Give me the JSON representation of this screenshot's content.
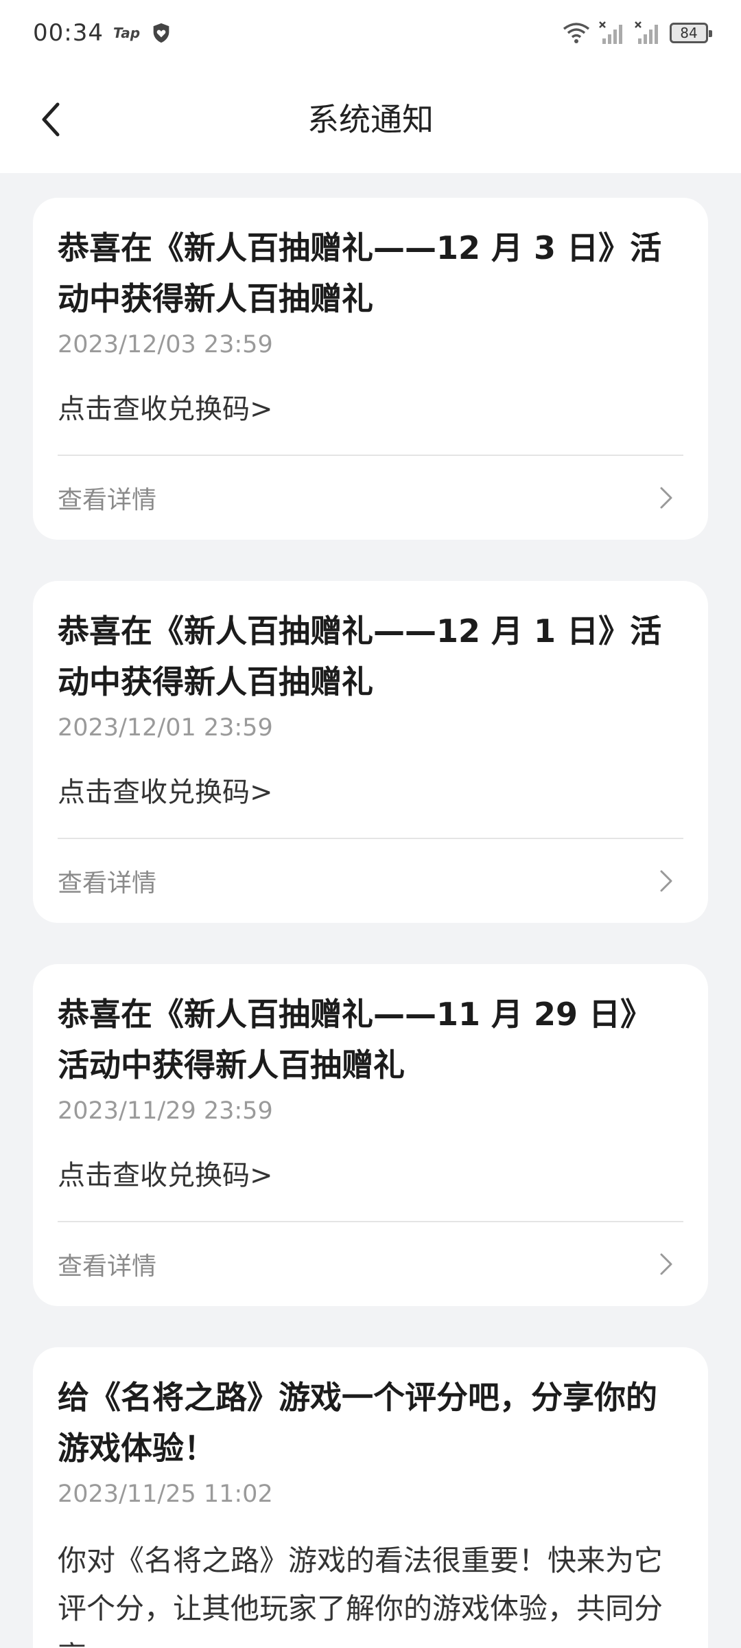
{
  "status_bar": {
    "time": "00:34",
    "app_tag": "Tap",
    "battery": "84"
  },
  "header": {
    "title": "系统通知"
  },
  "notifications": [
    {
      "title": "恭喜在《新人百抽赠礼——12 月 3 日》活动中获得新人百抽赠礼",
      "time": "2023/12/03 23:59",
      "body": "点击查收兑换码>",
      "detail_label": "查看详情"
    },
    {
      "title": "恭喜在《新人百抽赠礼——12 月 1 日》活动中获得新人百抽赠礼",
      "time": "2023/12/01 23:59",
      "body": "点击查收兑换码>",
      "detail_label": "查看详情"
    },
    {
      "title": "恭喜在《新人百抽赠礼——11 月 29 日》活动中获得新人百抽赠礼",
      "time": "2023/11/29 23:59",
      "body": "点击查收兑换码>",
      "detail_label": "查看详情"
    },
    {
      "title": "给《名将之路》游戏一个评分吧，分享你的游戏体验！",
      "time": "2023/11/25 11:02",
      "body": "你对《名将之路》游戏的看法很重要！快来为它评个分，让其他玩家了解你的游戏体验，共同分享"
    }
  ]
}
